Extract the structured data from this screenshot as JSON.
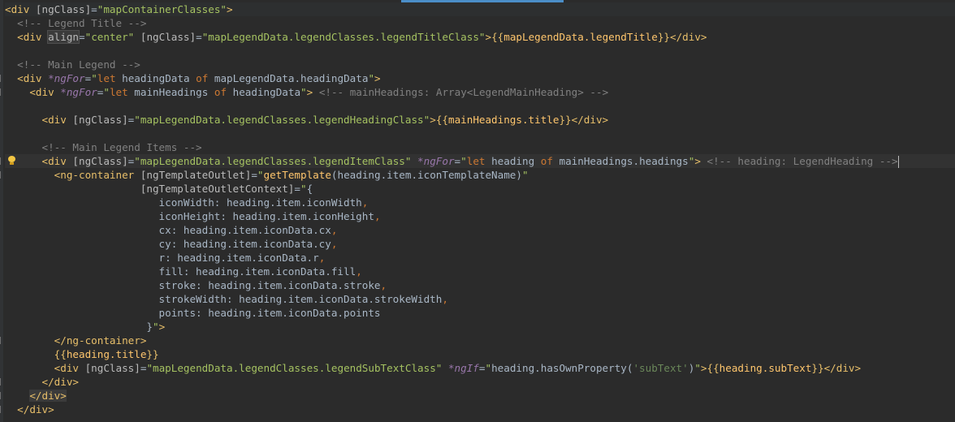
{
  "editor": {
    "lines": [
      {
        "id": "l1",
        "parts": [
          [
            "tag",
            "<div "
          ],
          [
            "attr",
            "[ngClass]"
          ],
          [
            "ident",
            "="
          ],
          [
            "str",
            "\"mapContainerClasses\""
          ],
          [
            "tag",
            ">"
          ]
        ]
      },
      {
        "id": "l2",
        "parts": [
          [
            "ident",
            "  "
          ],
          [
            "cmt",
            "<!-- Legend Title -->"
          ]
        ]
      },
      {
        "id": "l3",
        "parts": [
          [
            "ident",
            "  "
          ],
          [
            "tag",
            "<div "
          ],
          [
            "attrbox",
            "align"
          ],
          [
            "ident",
            "="
          ],
          [
            "str",
            "\"center\" "
          ],
          [
            "attr",
            "[ngClass]"
          ],
          [
            "ident",
            "="
          ],
          [
            "str",
            "\"mapLegendData.legendClasses.legendTitleClass\""
          ],
          [
            "tag",
            ">"
          ],
          [
            "brace",
            "{{"
          ],
          [
            "fn",
            "mapLegendData.legendTitle"
          ],
          [
            "brace",
            "}}"
          ],
          [
            "tag",
            "</div>"
          ]
        ]
      },
      {
        "id": "l4",
        "parts": []
      },
      {
        "id": "l5",
        "parts": [
          [
            "ident",
            "  "
          ],
          [
            "cmt",
            "<!-- Main Legend -->"
          ]
        ]
      },
      {
        "id": "l6",
        "parts": [
          [
            "ident",
            "  "
          ],
          [
            "tag",
            "<div "
          ],
          [
            "dir",
            "*ngFor"
          ],
          [
            "ident",
            "="
          ],
          [
            "str",
            "\""
          ],
          [
            "kw",
            "let "
          ],
          [
            "ident",
            "headingData "
          ],
          [
            "kw",
            "of "
          ],
          [
            "ident",
            "mapLegendData.headingData"
          ],
          [
            "str",
            "\""
          ],
          [
            "tag",
            ">"
          ]
        ]
      },
      {
        "id": "l7",
        "parts": [
          [
            "ident",
            "    "
          ],
          [
            "tag",
            "<div "
          ],
          [
            "dir",
            "*ngFor"
          ],
          [
            "ident",
            "="
          ],
          [
            "str",
            "\""
          ],
          [
            "kw",
            "let "
          ],
          [
            "ident",
            "mainHeadings "
          ],
          [
            "kw",
            "of "
          ],
          [
            "ident",
            "headingData"
          ],
          [
            "str",
            "\""
          ],
          [
            "tag",
            ">"
          ],
          [
            "ident",
            " "
          ],
          [
            "cmt",
            "<!-- mainHeadings: Array<LegendMainHeading> -->"
          ]
        ]
      },
      {
        "id": "l8",
        "parts": []
      },
      {
        "id": "l9",
        "parts": [
          [
            "ident",
            "      "
          ],
          [
            "tag",
            "<div "
          ],
          [
            "attr",
            "[ngClass]"
          ],
          [
            "ident",
            "="
          ],
          [
            "str",
            "\"mapLegendData.legendClasses.legendHeadingClass\""
          ],
          [
            "tag",
            ">"
          ],
          [
            "brace",
            "{{"
          ],
          [
            "fn",
            "mainHeadings.title"
          ],
          [
            "brace",
            "}}"
          ],
          [
            "tag",
            "</div>"
          ]
        ]
      },
      {
        "id": "l10",
        "parts": []
      },
      {
        "id": "l11",
        "parts": [
          [
            "ident",
            "      "
          ],
          [
            "cmt",
            "<!-- Main Legend Items -->"
          ]
        ]
      },
      {
        "id": "l12",
        "hl": true,
        "bulb": true,
        "caret": true,
        "parts": [
          [
            "ident",
            "      "
          ],
          [
            "tag",
            "<div "
          ],
          [
            "attr",
            "[ngClass]"
          ],
          [
            "ident",
            "="
          ],
          [
            "str",
            "\"mapLegendData.legendClasses.legendItemClass\" "
          ],
          [
            "dir",
            "*ngFor"
          ],
          [
            "ident",
            "="
          ],
          [
            "str",
            "\""
          ],
          [
            "kw",
            "let "
          ],
          [
            "ident",
            "heading "
          ],
          [
            "kw",
            "of "
          ],
          [
            "ident",
            "mainHeadings.headings"
          ],
          [
            "str",
            "\""
          ],
          [
            "tag",
            ">"
          ],
          [
            "ident",
            " "
          ],
          [
            "cmt",
            "<!-- heading: LegendHeading -->"
          ]
        ]
      },
      {
        "id": "l13",
        "parts": [
          [
            "ident",
            "        "
          ],
          [
            "tag",
            "<ng-container "
          ],
          [
            "attr",
            "[ngTemplateOutlet]"
          ],
          [
            "ident",
            "="
          ],
          [
            "str",
            "\""
          ],
          [
            "fn",
            "getTemplate"
          ],
          [
            "ident",
            "(heading.item.iconTemplateName)"
          ],
          [
            "str",
            "\""
          ]
        ]
      },
      {
        "id": "l14",
        "parts": [
          [
            "ident",
            "                      "
          ],
          [
            "attr",
            "[ngTemplateOutletContext]"
          ],
          [
            "ident",
            "="
          ],
          [
            "str",
            "\""
          ],
          [
            "ident",
            "{"
          ]
        ]
      },
      {
        "id": "l15",
        "parts": [
          [
            "ident",
            "                         iconWidth: heading.item.iconWidth"
          ],
          [
            "kw",
            ","
          ]
        ]
      },
      {
        "id": "l16",
        "parts": [
          [
            "ident",
            "                         iconHeight: heading.item.iconHeight"
          ],
          [
            "kw",
            ","
          ]
        ]
      },
      {
        "id": "l17",
        "parts": [
          [
            "ident",
            "                         cx: heading.item.iconData.cx"
          ],
          [
            "kw",
            ","
          ]
        ]
      },
      {
        "id": "l18",
        "parts": [
          [
            "ident",
            "                         cy: heading.item.iconData.cy"
          ],
          [
            "kw",
            ","
          ]
        ]
      },
      {
        "id": "l19",
        "parts": [
          [
            "ident",
            "                         r: heading.item.iconData.r"
          ],
          [
            "kw",
            ","
          ]
        ]
      },
      {
        "id": "l20",
        "parts": [
          [
            "ident",
            "                         fill: heading.item.iconData.fill"
          ],
          [
            "kw",
            ","
          ]
        ]
      },
      {
        "id": "l21",
        "parts": [
          [
            "ident",
            "                         stroke: heading.item.iconData.stroke"
          ],
          [
            "kw",
            ","
          ]
        ]
      },
      {
        "id": "l22",
        "parts": [
          [
            "ident",
            "                         strokeWidth: heading.item.iconData.strokeWidth"
          ],
          [
            "kw",
            ","
          ]
        ]
      },
      {
        "id": "l23",
        "parts": [
          [
            "ident",
            "                         points: heading.item.iconData.points"
          ]
        ]
      },
      {
        "id": "l24",
        "parts": [
          [
            "ident",
            "                       }"
          ],
          [
            "str",
            "\""
          ],
          [
            "tag",
            ">"
          ]
        ]
      },
      {
        "id": "l25",
        "parts": [
          [
            "ident",
            "        "
          ],
          [
            "tag",
            "</ng-container>"
          ]
        ]
      },
      {
        "id": "l26",
        "parts": [
          [
            "ident",
            "        "
          ],
          [
            "brace",
            "{{"
          ],
          [
            "fn",
            "heading.title"
          ],
          [
            "brace",
            "}}"
          ]
        ]
      },
      {
        "id": "l27",
        "parts": [
          [
            "ident",
            "        "
          ],
          [
            "tag",
            "<div "
          ],
          [
            "attr",
            "[ngClass]"
          ],
          [
            "ident",
            "="
          ],
          [
            "str",
            "\"mapLegendData.legendClasses.legendSubTextClass\" "
          ],
          [
            "dir",
            "*ngIf"
          ],
          [
            "ident",
            "="
          ],
          [
            "str",
            "\""
          ],
          [
            "ident",
            "heading.hasOwnProperty("
          ],
          [
            "tpl",
            "'subText'"
          ],
          [
            "ident",
            ")"
          ],
          [
            "str",
            "\""
          ],
          [
            "tag",
            ">"
          ],
          [
            "brace",
            "{{"
          ],
          [
            "fn",
            "heading.subText"
          ],
          [
            "brace",
            "}}"
          ],
          [
            "tag",
            "</div>"
          ]
        ]
      },
      {
        "id": "l28",
        "parts": [
          [
            "ident",
            "      "
          ],
          [
            "tag",
            "</div>"
          ]
        ]
      },
      {
        "id": "l29",
        "parts": [
          [
            "ident",
            "    "
          ],
          [
            "tagbox",
            "</div>"
          ]
        ]
      },
      {
        "id": "l30",
        "parts": [
          [
            "ident",
            "  "
          ],
          [
            "tag",
            "</div>"
          ]
        ]
      }
    ]
  }
}
